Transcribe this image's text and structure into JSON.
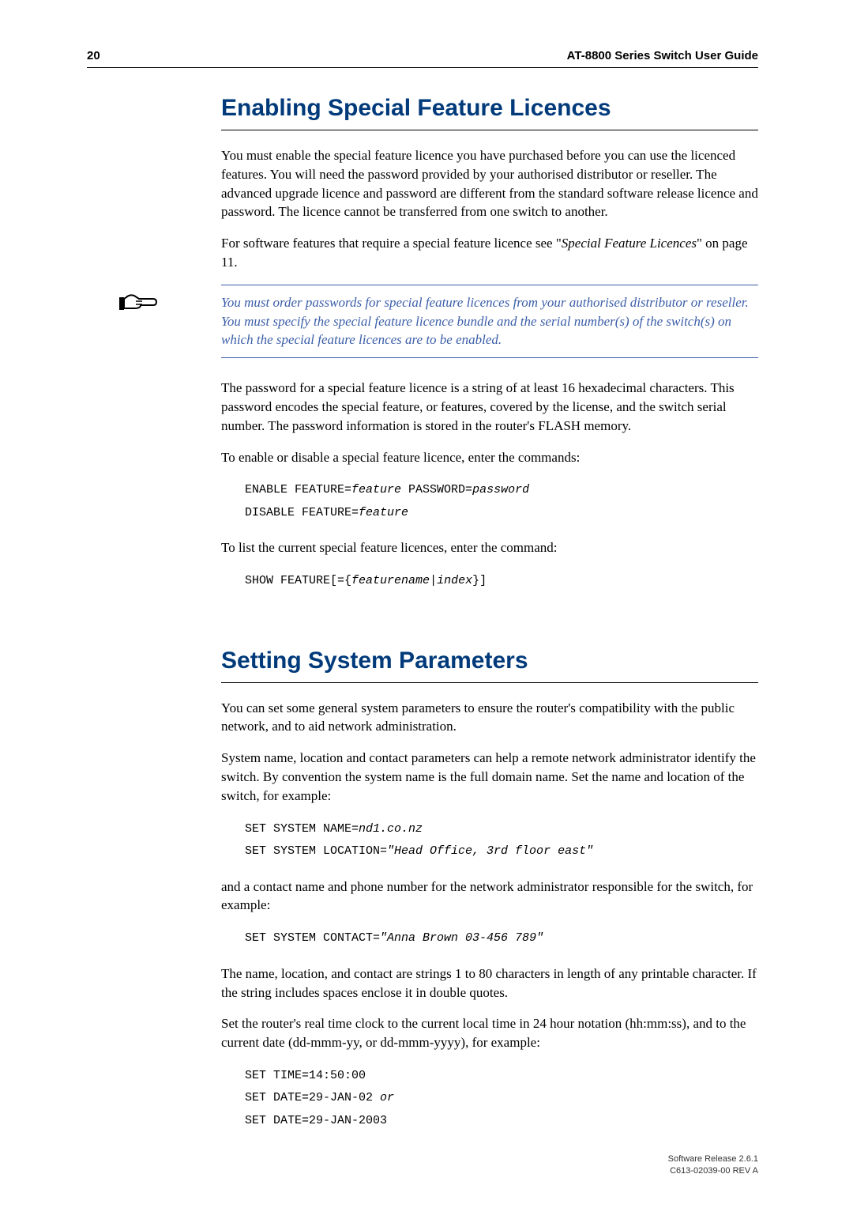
{
  "header": {
    "page_number": "20",
    "doc_title": "AT-8800 Series Switch User Guide"
  },
  "section1": {
    "heading": "Enabling Special Feature Licences",
    "para1": "You must enable the special feature licence you have purchased before you can use the licenced features. You will need the password provided by your authorised distributor or reseller. The advanced upgrade licence and password are different from the standard software release licence and password. The licence cannot be transferred from one switch to another.",
    "para2_pre": "For software features that require a special feature licence see \"",
    "para2_ital": "Special Feature Licences",
    "para2_post": "\" on page 11.",
    "note": "You must order passwords for special feature licences from your authorised distributor or reseller. You must specify the special feature licence bundle and the serial number(s) of the switch(s) on which the special feature licences are to be enabled.",
    "para3": "The password for a special feature licence is a string of at least 16 hexadecimal characters. This password encodes the special feature, or features, covered by the license, and the switch serial number. The password information is stored in the router's FLASH memory.",
    "para4": "To enable or disable a special feature licence, enter the commands:",
    "cmd1_a": "ENABLE FEATURE=",
    "cmd1_b": "feature",
    "cmd1_c": " PASSWORD=",
    "cmd1_d": "password",
    "cmd2_a": "DISABLE FEATURE=",
    "cmd2_b": "feature",
    "para5": "To list the current special feature licences, enter the command:",
    "cmd3_a": "SHOW FEATURE[={",
    "cmd3_b": "featurename",
    "cmd3_c": "|",
    "cmd3_d": "index",
    "cmd3_e": "}]"
  },
  "section2": {
    "heading": "Setting System Parameters",
    "para1": "You can set some general system parameters to ensure the router's compatibility with the public network, and to aid network administration.",
    "para2": "System name, location and contact parameters can help a remote network administrator identify the switch. By convention the system name is the full domain name. Set the name and location of the switch, for example:",
    "cmd1_a": "SET SYSTEM NAME=",
    "cmd1_b": "nd1.co.nz",
    "cmd2_a": "SET SYSTEM LOCATION=",
    "cmd2_b": "\"Head Office, 3rd floor east\"",
    "para3": "and a contact name and phone number for the network administrator responsible for the switch, for example:",
    "cmd3_a": "SET SYSTEM CONTACT=",
    "cmd3_b": "\"Anna Brown 03-456 789\"",
    "para4": "The name, location, and contact are strings 1 to 80 characters in length of any printable character. If the string includes spaces enclose it in double quotes.",
    "para5": "Set the router's real time clock to the current local time in 24 hour notation (hh:mm:ss), and to the current date (dd-mmm-yy, or dd-mmm-yyyy), for example:",
    "cmd4": "SET TIME=14:50:00",
    "cmd5_a": "SET DATE=29-JAN-02 ",
    "cmd5_b": "or",
    "cmd6": "SET DATE=29-JAN-2003"
  },
  "footer": {
    "line1": "Software Release 2.6.1",
    "line2": "C613-02039-00 REV A"
  }
}
